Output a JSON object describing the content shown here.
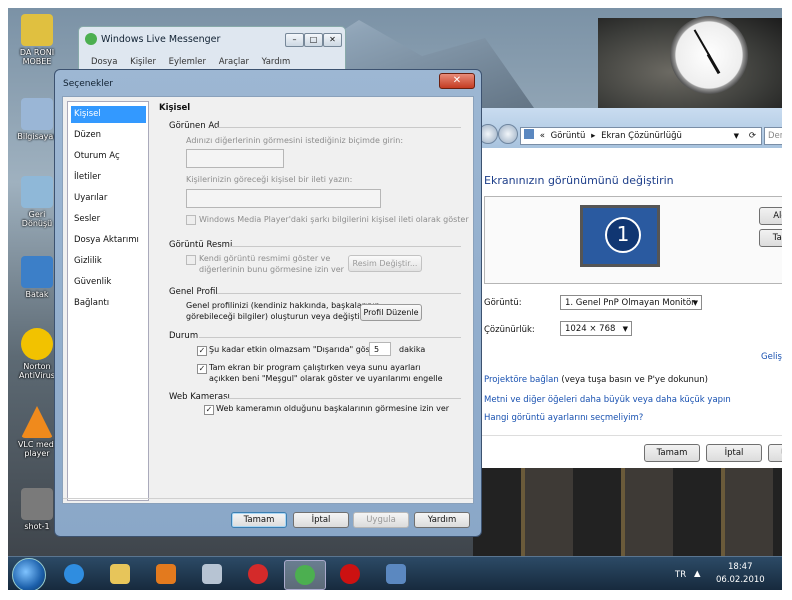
{
  "desktop": {
    "icons": [
      {
        "label": "DA RONI\nMOBEE",
        "color": "#e0c040"
      },
      {
        "label": "Bilgisayar",
        "color": "#9ab6d6"
      },
      {
        "label": "Geri\nDönüşü",
        "color": "#8fb8d8"
      },
      {
        "label": "Batak",
        "color": "#3c7fc8"
      },
      {
        "label": "Norton\nAntiVirus",
        "color": "#f2c200"
      },
      {
        "label": "VLC medi\nplayer",
        "color": "#f08a1c"
      },
      {
        "label": "shot-1",
        "color": "#7a7a7a"
      }
    ]
  },
  "messenger": {
    "title": "Windows Live Messenger",
    "menu": [
      "Dosya",
      "Kişiler",
      "Eylemler",
      "Araçlar",
      "Yardım"
    ]
  },
  "display": {
    "address": [
      "Görüntü",
      "Ekran Çözünürlüğü"
    ],
    "search_partial": "Der",
    "heading": "Ekranınızın görünümünü değiştirin",
    "detect_btn": "Alg",
    "identify_btn": "Tan",
    "monitor_number": "1",
    "display_label": "Görüntü:",
    "display_value": "1. Genel PnP Olmayan Monitör",
    "resolution_label": "Çözünürlük:",
    "resolution_value": "1024 × 768",
    "advanced_link": "Gelişm",
    "projector_link": "Projektöre bağlan",
    "projector_text": " (veya tuşa basın   ve P'ye dokunun)",
    "text_size_link": "Metni ve diğer öğeleri daha büyük veya daha küçük yapın",
    "which_link": "Hangi görüntü ayarlarını seçmeliyim?",
    "ok": "Tamam",
    "cancel": "İptal",
    "apply_partial": "U"
  },
  "dialog": {
    "title": "Seçenekler",
    "nav": [
      "Kişisel",
      "Düzen",
      "Oturum Aç",
      "İletiler",
      "Uyarılar",
      "Sesler",
      "Dosya Aktarımı",
      "Gizlilik",
      "Güvenlik",
      "Bağlantı"
    ],
    "panel_title": "Kişisel",
    "display_name": {
      "header": "Görünen Ad",
      "desc": "Adınızı diğerlerinin görmesini istediğiniz biçimde girin:",
      "msg_label": "Kişilerinizin göreceği kişisel bir ileti yazın:",
      "wmp": "Windows Media Player'daki şarkı bilgilerini kişisel ileti olarak göster"
    },
    "picture": {
      "header": "Görüntü Resmi",
      "desc1": "Kendi görüntü resmimi göster ve",
      "desc2": "diğerlerinin bunu görmesine izin ver",
      "change_btn": "Resim Değiştir..."
    },
    "profile": {
      "header": "Genel Profil",
      "desc1": "Genel profilinizi (kendiniz hakkında, başkalarının",
      "desc2": "görebileceği bilgiler) oluşturun veya değiştirin",
      "edit_btn": "Profil Düzenle"
    },
    "status": {
      "header": "Durum",
      "away_label": "Şu kadar etkin olmazsam \"Dışarıda\" göster:",
      "away_value": "5",
      "away_unit": "dakika",
      "busy1": "Tam ekran bir program çalıştırken veya sunu ayarları",
      "busy2": "açıkken beni \"Meşgul\" olarak göster ve uyarılarımı engelle"
    },
    "webcam": {
      "header": "Web Kamerası",
      "label": "Web kameramın olduğunu başkalarının görmesine izin ver"
    },
    "buttons": {
      "ok": "Tamam",
      "cancel": "İptal",
      "apply": "Uygula",
      "help": "Yardım"
    }
  },
  "taskbar": {
    "lang": "TR",
    "time": "18:47",
    "date": "06.02.2010"
  }
}
